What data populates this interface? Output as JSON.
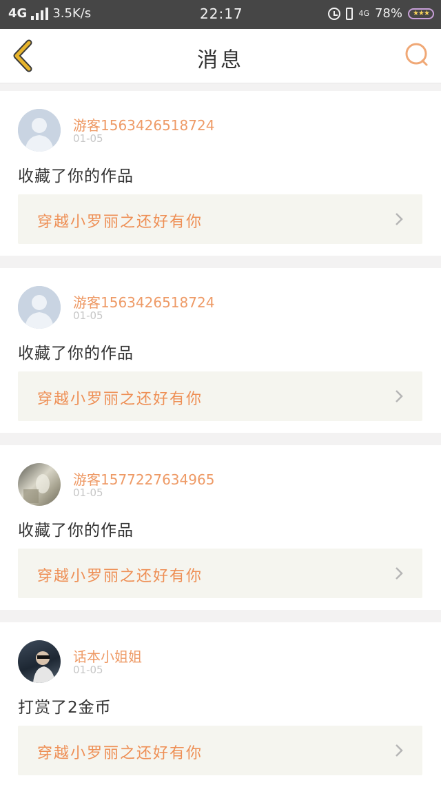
{
  "status_bar": {
    "network": "4G",
    "speed": "3.5K/s",
    "time": "22:17",
    "network_right": "4G",
    "battery": "78%"
  },
  "header": {
    "title": "消息"
  },
  "messages": [
    {
      "name": "游客1563426518724",
      "date": "01-05",
      "action": "收藏了你的作品",
      "work_title": "穿越小罗丽之还好有你",
      "avatar": "default"
    },
    {
      "name": "游客1563426518724",
      "date": "01-05",
      "action": "收藏了你的作品",
      "work_title": "穿越小罗丽之还好有你",
      "avatar": "default"
    },
    {
      "name": "游客1577227634965",
      "date": "01-05",
      "action": "收藏了你的作品",
      "work_title": "穿越小罗丽之还好有你",
      "avatar": "photo"
    },
    {
      "name": "话本小姐姐",
      "date": "01-05",
      "action": "打赏了2金币",
      "work_title": "穿越小罗丽之还好有你",
      "avatar": "photo"
    }
  ],
  "colors": {
    "accent": "#ee9a66",
    "back_arrow": "#e7b42c",
    "status_bg": "#464646"
  }
}
